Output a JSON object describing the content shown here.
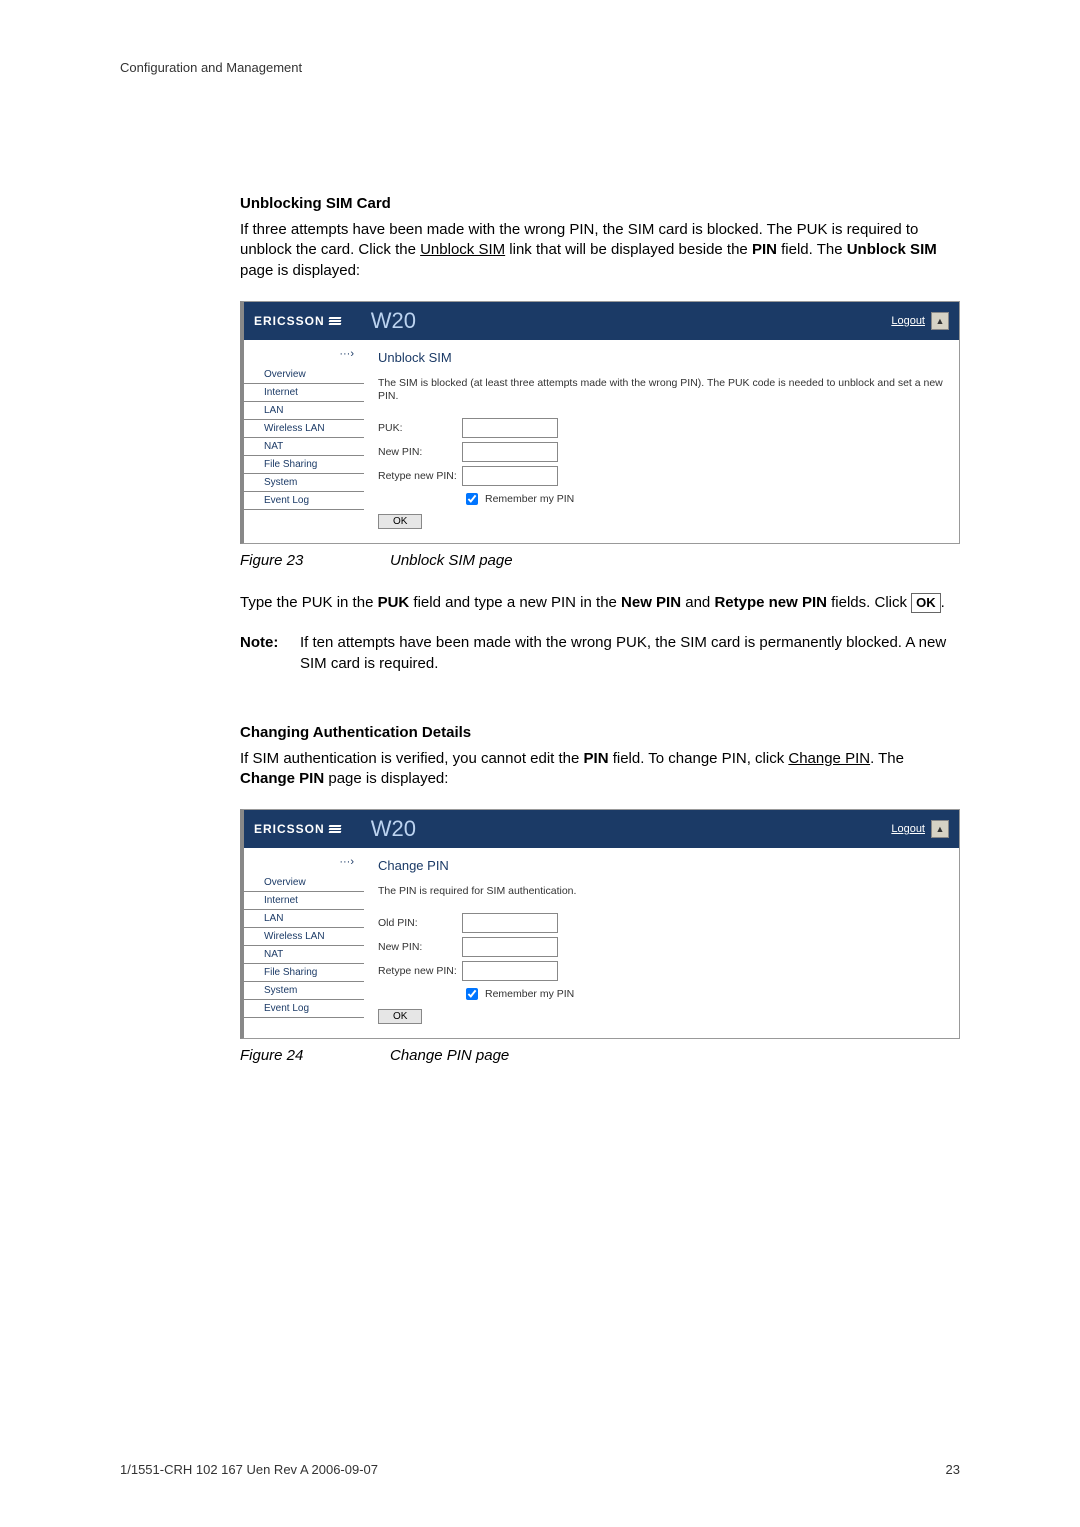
{
  "running_header": "Configuration and Management",
  "section1_title": "Unblocking SIM Card",
  "section1_para_pre": "If three attempts have been made with the wrong PIN, the SIM card is blocked. The PUK is required to unblock the card. Click the ",
  "section1_para_link": "Unblock SIM",
  "section1_para_post1": " link that will be displayed beside the ",
  "section1_para_post2": " field. The ",
  "section1_para_post3": " page is displayed:",
  "pin_word": "PIN",
  "unblock_sim_words": "Unblock SIM",
  "app": {
    "brand": "ERICSSON",
    "product": "W20",
    "logout": "Logout"
  },
  "sidebar_items": [
    "Overview",
    "Internet",
    "LAN",
    "Wireless LAN",
    "NAT",
    "File Sharing",
    "System",
    "Event Log"
  ],
  "fig1": {
    "panel_title": "Unblock SIM",
    "message": "The SIM is blocked (at least three attempts made with the wrong PIN). The PUK code is needed to unblock and set a new PIN.",
    "labels": {
      "puk": "PUK:",
      "new_pin": "New PIN:",
      "retype": "Retype new PIN:"
    },
    "remember": "Remember my PIN",
    "ok": "OK"
  },
  "caption1": {
    "fig": "Figure 23",
    "text": "Unblock SIM page"
  },
  "after_fig1_pre": "Type the PUK in the ",
  "bold_puk": "PUK",
  "after_fig1_mid1": " field and type a new PIN in the ",
  "bold_newpin": "New PIN",
  "after_fig1_mid2": " and ",
  "bold_retype": "Retype new PIN",
  "after_fig1_mid3": " fields. Click ",
  "ok_inline": "OK",
  "after_fig1_end": ".",
  "note_label": "Note:",
  "note_text": "If ten attempts have been made with the wrong PUK, the SIM card is permanently blocked. A new SIM card is required.",
  "section2_title": "Changing Authentication Details",
  "section2_para_pre": "If SIM authentication is verified, you cannot edit the ",
  "section2_para_mid": " field. To change PIN, click ",
  "change_pin_link": "Change PIN",
  "section2_para_post": ". The ",
  "change_pin_bold": "Change PIN",
  "section2_para_end": " page is displayed:",
  "fig2": {
    "panel_title": "Change PIN",
    "message": "The PIN is required for SIM authentication.",
    "labels": {
      "old_pin": "Old PIN:",
      "new_pin": "New PIN:",
      "retype": "Retype new PIN:"
    },
    "remember": "Remember my PIN",
    "ok": "OK"
  },
  "caption2": {
    "fig": "Figure 24",
    "text": "Change PIN page"
  },
  "footer_left": "1/1551-CRH 102 167 Uen Rev A  2006-09-07",
  "footer_right": "23"
}
